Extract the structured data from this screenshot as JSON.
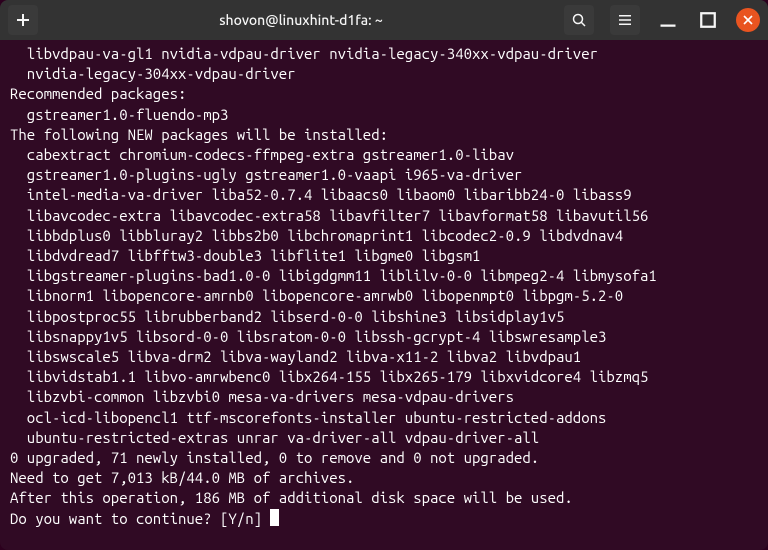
{
  "titlebar": {
    "title": "shovon@linuxhint-d1fa: ~"
  },
  "terminal": {
    "lines": [
      "  libvdpau-va-gl1 nvidia-vdpau-driver nvidia-legacy-340xx-vdpau-driver",
      "  nvidia-legacy-304xx-vdpau-driver",
      "Recommended packages:",
      "  gstreamer1.0-fluendo-mp3",
      "The following NEW packages will be installed:",
      "  cabextract chromium-codecs-ffmpeg-extra gstreamer1.0-libav",
      "  gstreamer1.0-plugins-ugly gstreamer1.0-vaapi i965-va-driver",
      "  intel-media-va-driver liba52-0.7.4 libaacs0 libaom0 libaribb24-0 libass9",
      "  libavcodec-extra libavcodec-extra58 libavfilter7 libavformat58 libavutil56",
      "  libbdplus0 libbluray2 libbs2b0 libchromaprint1 libcodec2-0.9 libdvdnav4",
      "  libdvdread7 libfftw3-double3 libflite1 libgme0 libgsm1",
      "  libgstreamer-plugins-bad1.0-0 libigdgmm11 liblilv-0-0 libmpeg2-4 libmysofa1",
      "  libnorm1 libopencore-amrnb0 libopencore-amrwb0 libopenmpt0 libpgm-5.2-0",
      "  libpostproc55 librubberband2 libserd-0-0 libshine3 libsidplay1v5",
      "  libsnappy1v5 libsord-0-0 libsratom-0-0 libssh-gcrypt-4 libswresample3",
      "  libswscale5 libva-drm2 libva-wayland2 libva-x11-2 libva2 libvdpau1",
      "  libvidstab1.1 libvo-amrwbenc0 libx264-155 libx265-179 libxvidcore4 libzmq5",
      "  libzvbi-common libzvbi0 mesa-va-drivers mesa-vdpau-drivers",
      "  ocl-icd-libopencl1 ttf-mscorefonts-installer ubuntu-restricted-addons",
      "  ubuntu-restricted-extras unrar va-driver-all vdpau-driver-all",
      "0 upgraded, 71 newly installed, 0 to remove and 0 not upgraded.",
      "Need to get 7,013 kB/44.0 MB of archives.",
      "After this operation, 186 MB of additional disk space will be used.",
      "Do you want to continue? [Y/n] "
    ]
  }
}
